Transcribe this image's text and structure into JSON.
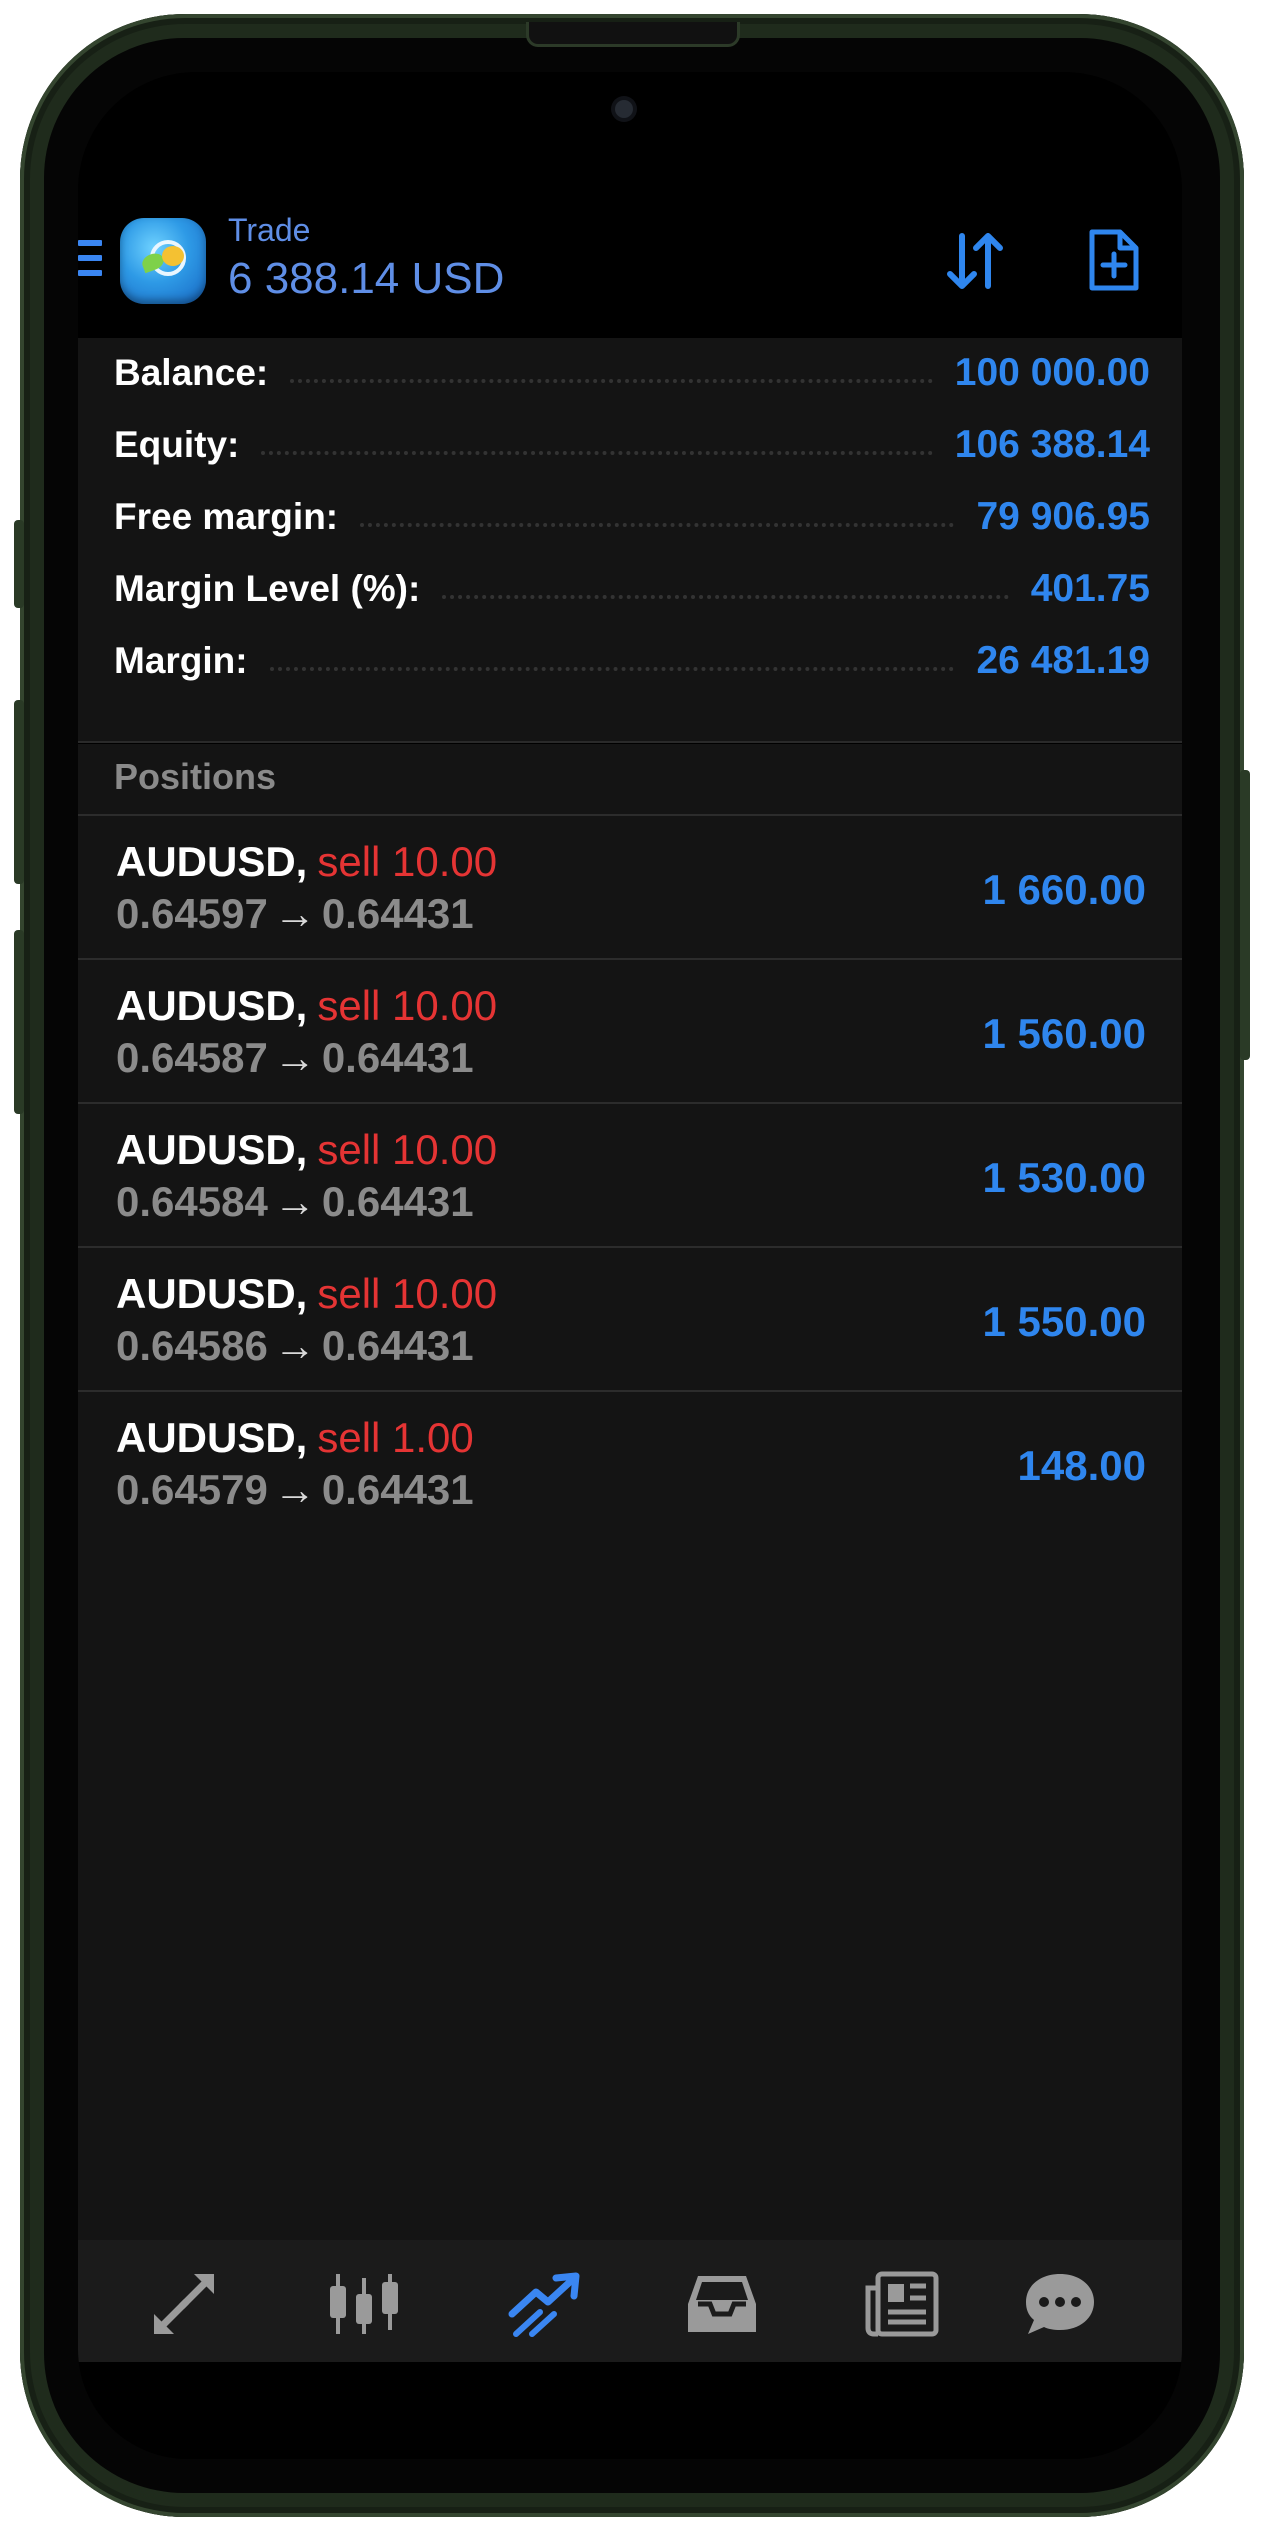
{
  "header": {
    "title": "Trade",
    "balance_text": "6 388.14 USD"
  },
  "summary": [
    {
      "label": "Balance:",
      "value": "100 000.00"
    },
    {
      "label": "Equity:",
      "value": "106 388.14"
    },
    {
      "label": "Free margin:",
      "value": "79 906.95"
    },
    {
      "label": "Margin Level (%):",
      "value": "401.75"
    },
    {
      "label": "Margin:",
      "value": "26 481.19"
    }
  ],
  "positions_title": "Positions",
  "positions": [
    {
      "symbol": "AUDUSD,",
      "side": "sell 10.00",
      "open_price": "0.64597",
      "arrow": "→",
      "current_price": "0.64431",
      "profit": "1 660.00"
    },
    {
      "symbol": "AUDUSD,",
      "side": "sell 10.00",
      "open_price": "0.64587",
      "arrow": "→",
      "current_price": "0.64431",
      "profit": "1 560.00"
    },
    {
      "symbol": "AUDUSD,",
      "side": "sell 10.00",
      "open_price": "0.64584",
      "arrow": "→",
      "current_price": "0.64431",
      "profit": "1 530.00"
    },
    {
      "symbol": "AUDUSD,",
      "side": "sell 10.00",
      "open_price": "0.64586",
      "arrow": "→",
      "current_price": "0.64431",
      "profit": "1 550.00"
    },
    {
      "symbol": "AUDUSD,",
      "side": "sell 1.00",
      "open_price": "0.64579",
      "arrow": "→",
      "current_price": "0.64431",
      "profit": "148.00"
    }
  ],
  "bottom_nav": [
    {
      "icon": "quotes-icon",
      "active": false
    },
    {
      "icon": "chart-icon",
      "active": false
    },
    {
      "icon": "trade-icon",
      "active": true
    },
    {
      "icon": "history-icon",
      "active": false
    },
    {
      "icon": "news-icon",
      "active": false
    },
    {
      "icon": "messages-icon",
      "active": false
    }
  ],
  "colors": {
    "accent": "#2f86ee",
    "sell": "#e53434",
    "background": "#141414",
    "nav_inactive": "#9a9a9a"
  }
}
